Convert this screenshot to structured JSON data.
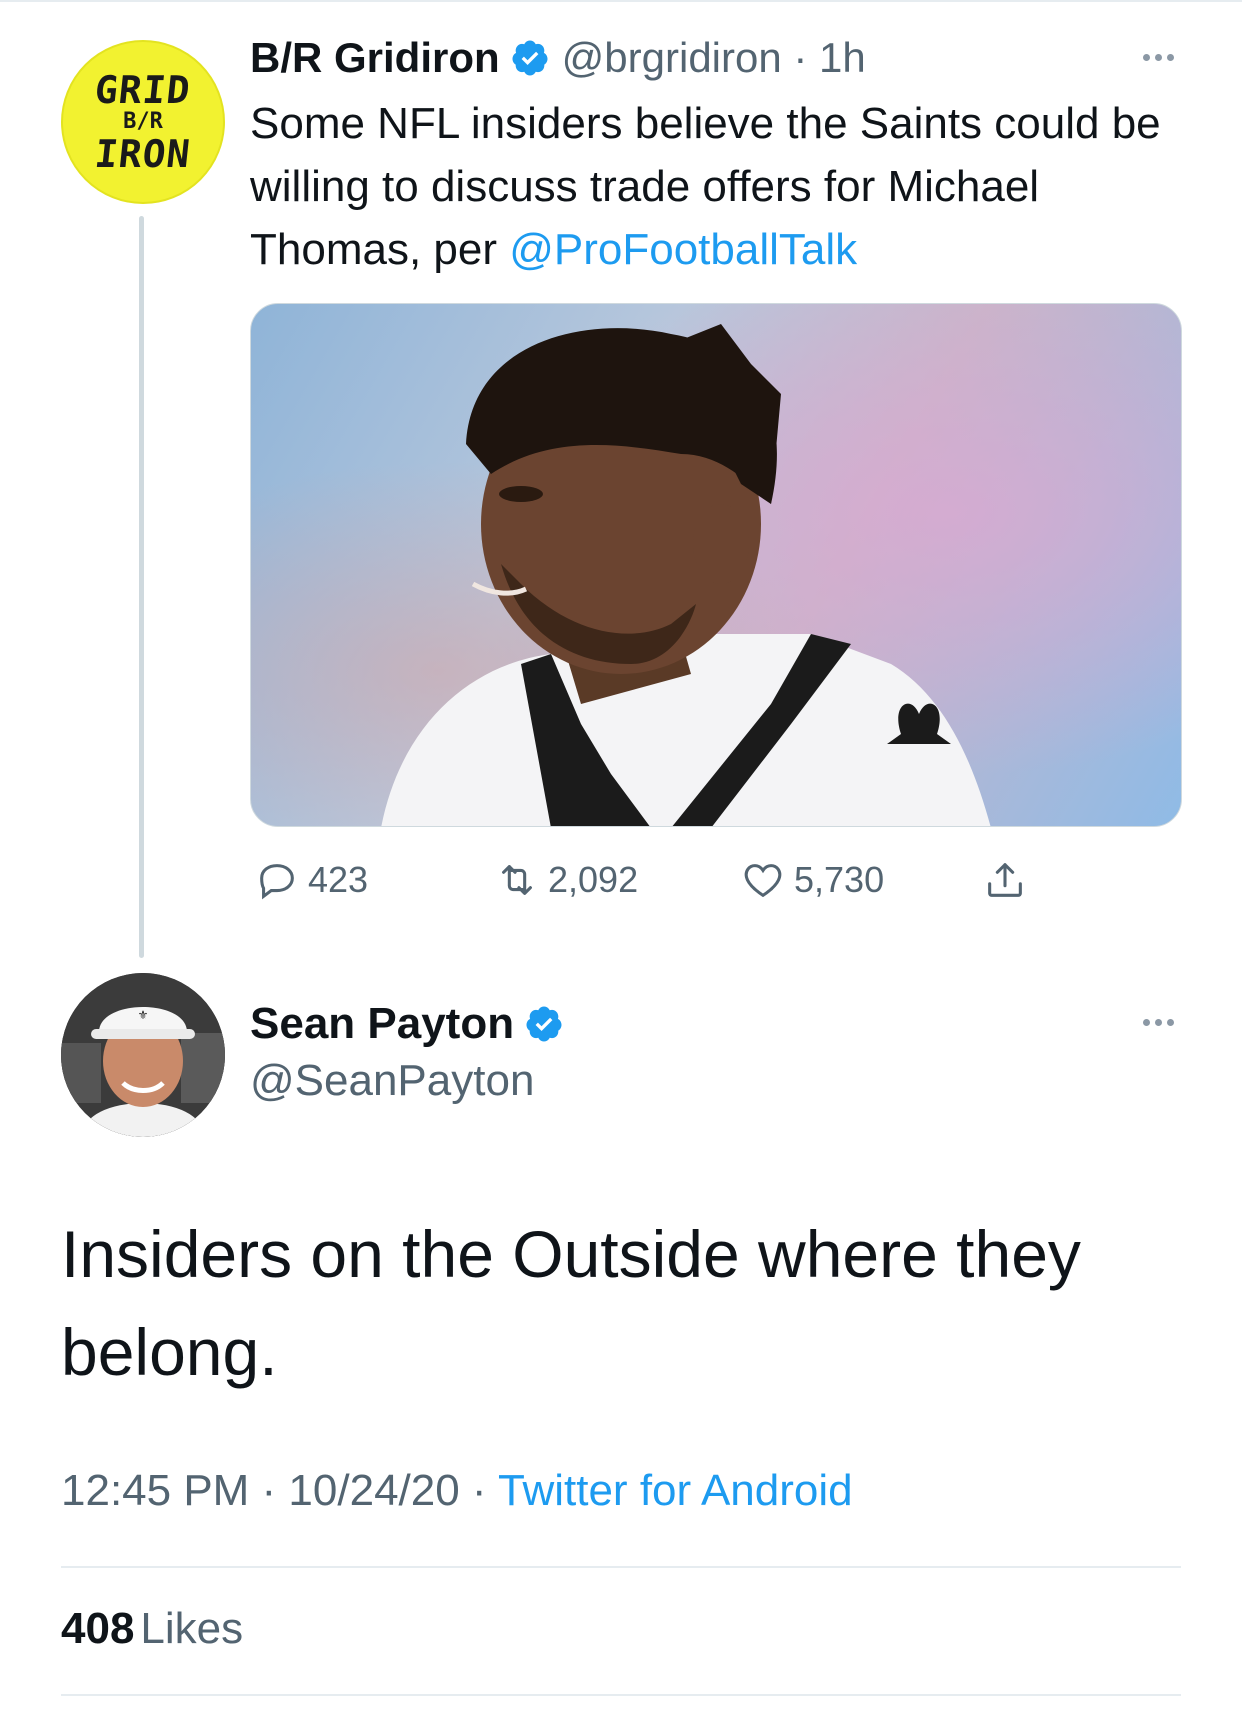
{
  "parent_tweet": {
    "avatar_logo": {
      "line1": "GRID",
      "line2": "B/R",
      "line3": "IRON"
    },
    "author_name": "B/R Gridiron",
    "verified": true,
    "handle_time": "@brgridiron · 1h",
    "text_main": "Some NFL insiders believe the Saints could be willing to discuss trade offers for Michael Thomas, per ",
    "text_mention": "@ProFootballTalk",
    "stats": {
      "replies": "423",
      "retweets": "2,092",
      "likes": "5,730"
    }
  },
  "main_tweet": {
    "author_name": "Sean Payton",
    "verified": true,
    "handle": "@SeanPayton",
    "text": "Insiders on the Outside where they belong.",
    "time_date": "12:45 PM · 10/24/20 · ",
    "source": "Twitter for Android",
    "likes_count": "408",
    "likes_label": "Likes"
  },
  "colors": {
    "accent": "#1d9bf0",
    "secondary_text": "#536471",
    "primary_text": "#0f1419",
    "br_logo_yellow": "#f2f230"
  },
  "icons": [
    "verified-badge-icon",
    "more-options-icon",
    "reply-icon",
    "retweet-icon",
    "like-icon",
    "share-icon"
  ]
}
